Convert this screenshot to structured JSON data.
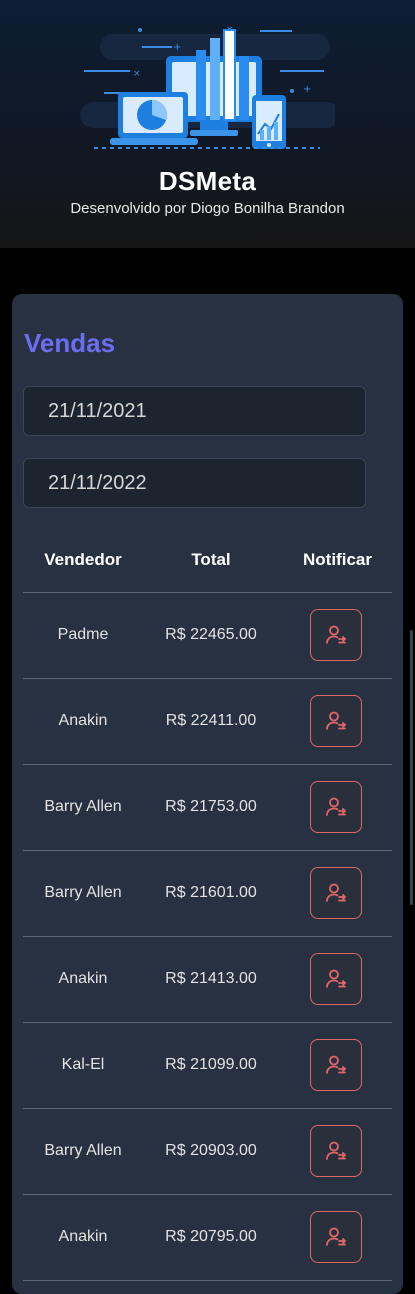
{
  "header": {
    "title": "DSMeta",
    "subtitle": "Desenvolvido por Diogo Bonilha Brandon",
    "logo_icon": "dashboard-devices-illustration"
  },
  "sales": {
    "title": "Vendas",
    "min_date": "21/11/2021",
    "max_date": "21/11/2022",
    "columns": [
      "Vendedor",
      "Total",
      "Notificar"
    ],
    "rows": [
      {
        "seller": "Padme",
        "total": "R$ 22465.00"
      },
      {
        "seller": "Anakin",
        "total": "R$ 22411.00"
      },
      {
        "seller": "Barry Allen",
        "total": "R$ 21753.00"
      },
      {
        "seller": "Barry Allen",
        "total": "R$ 21601.00"
      },
      {
        "seller": "Anakin",
        "total": "R$ 21413.00"
      },
      {
        "seller": "Kal-El",
        "total": "R$ 21099.00"
      },
      {
        "seller": "Barry Allen",
        "total": "R$ 20903.00"
      },
      {
        "seller": "Anakin",
        "total": "R$ 20795.00"
      }
    ],
    "notify_icon": "notify-user-icon"
  },
  "colors": {
    "accent": "#6c6ef2",
    "card": "#283142",
    "notify": "#e26767"
  }
}
